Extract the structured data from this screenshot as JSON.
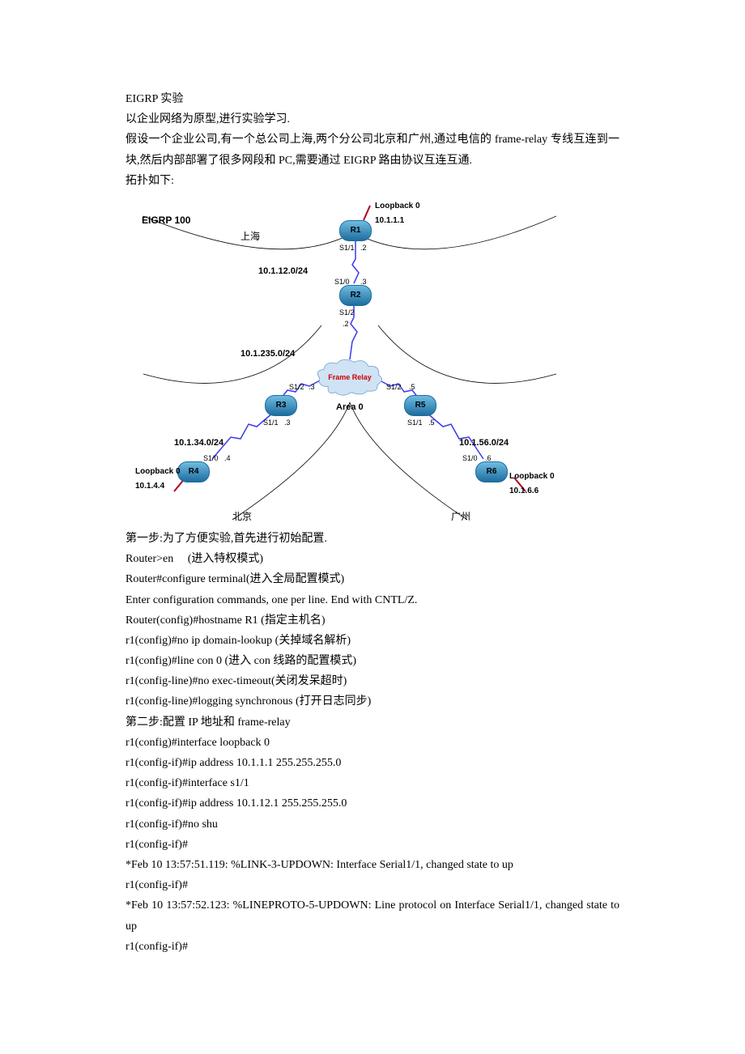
{
  "title": "EIGRP 实验",
  "intro": [
    "以企业网络为原型,进行实验学习.",
    "假设一个企业公司,有一个总公司上海,两个分公司北京和广州,通过电信的 frame-relay 专线互连到一块,然后内部部署了很多网段和 PC,需要通过 EIGRP 路由协议互连互通.",
    "拓扑如下:"
  ],
  "diagram": {
    "eigrp": "EIGRP 100",
    "shanghai": "上海",
    "beijing": "北京",
    "guangzhou": "广州",
    "frame_relay": "Frame Relay",
    "area0": "Area 0",
    "loop_r1": "Loopback 0\n10.1.1.1",
    "loop_r4": "Loopback 0\n10.1.4.4",
    "loop_r6": "Loopback 0\n10.1.6.6",
    "seg_12": "10.1.12.0/24",
    "seg_235": "10.1.235.0/24",
    "seg_34": "10.1.34.0/24",
    "seg_56": "10.1.56.0/24",
    "r1": "R1",
    "r2": "R2",
    "r3": "R3",
    "r4": "R4",
    "r5": "R5",
    "r6": "R6",
    "s11": "S1/1",
    "s10": "S1/0",
    "s12": "S1/2",
    "p2": ".2",
    "p3": ".3",
    "p4": ".4",
    "p5": ".5",
    "p6": ".6"
  },
  "step1_title": "第一步:为了方便实验,首先进行初始配置.",
  "step1_lines": [
    [
      "Router>en",
      "(进入特权模式)"
    ],
    "Router#configure terminal(进入全局配置模式)",
    "Enter configuration commands, one per line.    End with CNTL/Z.",
    "Router(config)#hostname R1 (指定主机名)",
    "r1(config)#no ip domain-lookup (关掉域名解析)",
    "r1(config)#line con 0 (进入 con 线路的配置模式)",
    "r1(config-line)#no exec-timeout(关闭发呆超时)",
    "r1(config-line)#logging synchronous (打开日志同步)"
  ],
  "step2_title": "第二步:配置 IP 地址和 frame-relay",
  "step2_lines": [
    "r1(config)#interface loopback 0",
    "r1(config-if)#ip address 10.1.1.1 255.255.255.0",
    "r1(config-if)#interface s1/1",
    "r1(config-if)#ip address 10.1.12.1 255.255.255.0",
    "r1(config-if)#no shu",
    "r1(config-if)#",
    "*Feb 10 13:57:51.119: %LINK-3-UPDOWN: Interface Serial1/1, changed state to up",
    "r1(config-if)#",
    "*Feb 10 13:57:52.123: %LINEPROTO-5-UPDOWN: Line protocol on Interface Serial1/1, changed state to up",
    "r1(config-if)#"
  ]
}
